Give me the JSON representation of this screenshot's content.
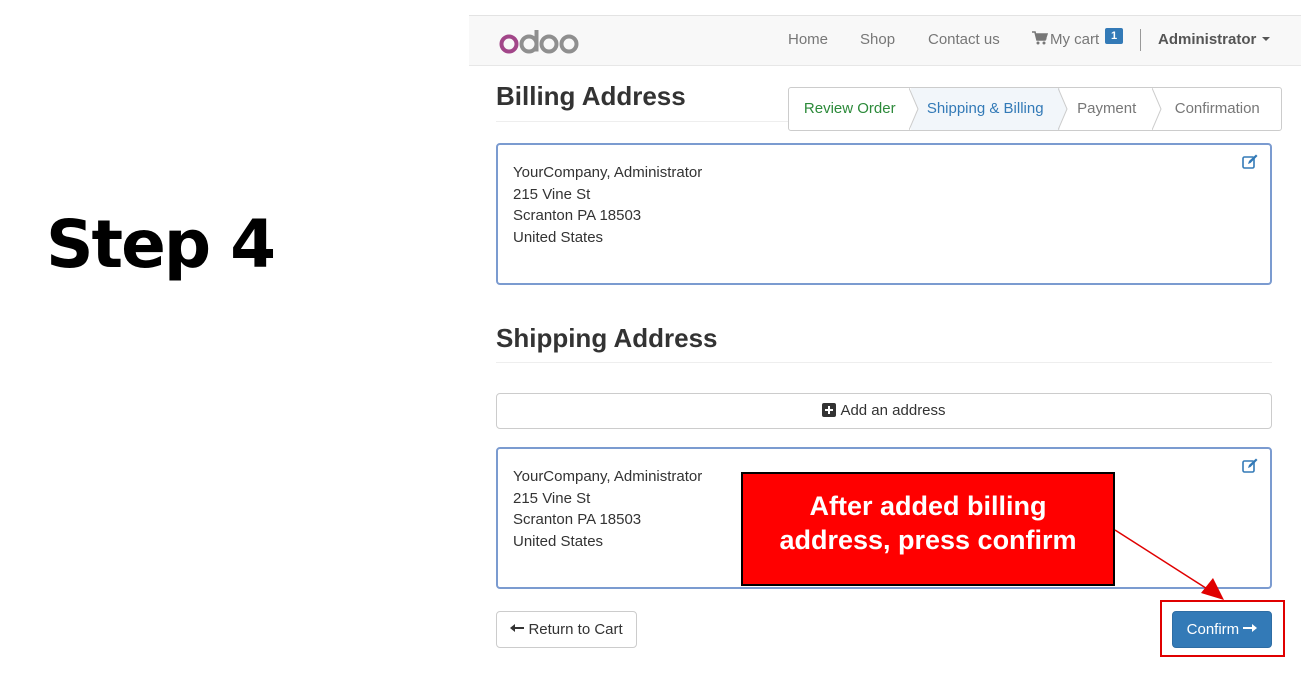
{
  "step_label": "Step 4",
  "brand": {
    "logo_text": "odoo"
  },
  "nav": {
    "home": "Home",
    "shop": "Shop",
    "contact": "Contact us",
    "cart_label": "My cart",
    "cart_count": "1",
    "user": "Administrator"
  },
  "billing": {
    "heading": "Billing Address",
    "address": [
      "YourCompany, Administrator",
      "215 Vine St",
      "Scranton PA 18503",
      "United States"
    ]
  },
  "wizard": {
    "steps": [
      "Review Order",
      "Shipping & Billing",
      "Payment",
      "Confirmation"
    ],
    "active": "Shipping & Billing"
  },
  "shipping": {
    "heading": "Shipping Address",
    "add_label": "Add an address",
    "address": [
      "YourCompany, Administrator",
      "215 Vine St",
      "Scranton PA 18503",
      "United States"
    ]
  },
  "actions": {
    "return_label": "Return to Cart",
    "confirm_label": "Confirm"
  },
  "annotation": {
    "line1": "After added billing",
    "line2": "address, press confirm"
  },
  "colors": {
    "primary": "#337ab7",
    "done_step": "#2c8a3a",
    "annotation_red": "#ff0000",
    "odoo_purple": "#a24689"
  }
}
